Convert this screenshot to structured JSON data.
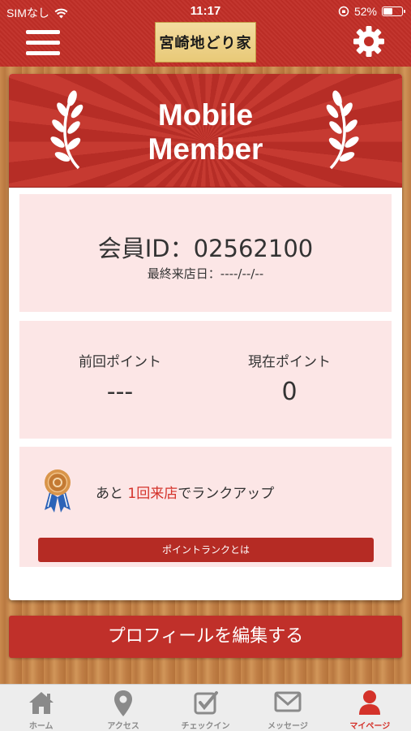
{
  "status": {
    "carrier": "SIMなし",
    "time": "11:17",
    "battery": "52%",
    "battery_level": 0.52
  },
  "header": {
    "menu_icon": "hamburger-icon",
    "logo_text": "宮崎地どり家",
    "settings_icon": "gear-icon"
  },
  "banner": {
    "line1": "Mobile",
    "line2": "Member"
  },
  "member": {
    "id_text": "会員ID：02562100",
    "last_visit": "最終来店日：----/--/--"
  },
  "points": {
    "previous_label": "前回ポイント",
    "previous_value": "---",
    "current_label": "現在ポイント",
    "current_value": "0"
  },
  "rank": {
    "prefix": "あと",
    "highlight": "1回来店",
    "suffix": "でランクアップ",
    "button_label": "ポイントランクとは",
    "highlight_color": "#d4322a"
  },
  "profile_button": "プロフィールを編集する",
  "tabs": [
    {
      "label": "ホーム",
      "icon": "home-icon"
    },
    {
      "label": "アクセス",
      "icon": "map-pin-icon"
    },
    {
      "label": "チェックイン",
      "icon": "checkin-icon"
    },
    {
      "label": "メッセージ",
      "icon": "mail-icon"
    },
    {
      "label": "マイページ",
      "icon": "person-icon",
      "active": true
    }
  ],
  "colors": {
    "brand_red": "#c12e27",
    "section_pink": "#fce6e6",
    "active_tab": "#d4322a"
  }
}
